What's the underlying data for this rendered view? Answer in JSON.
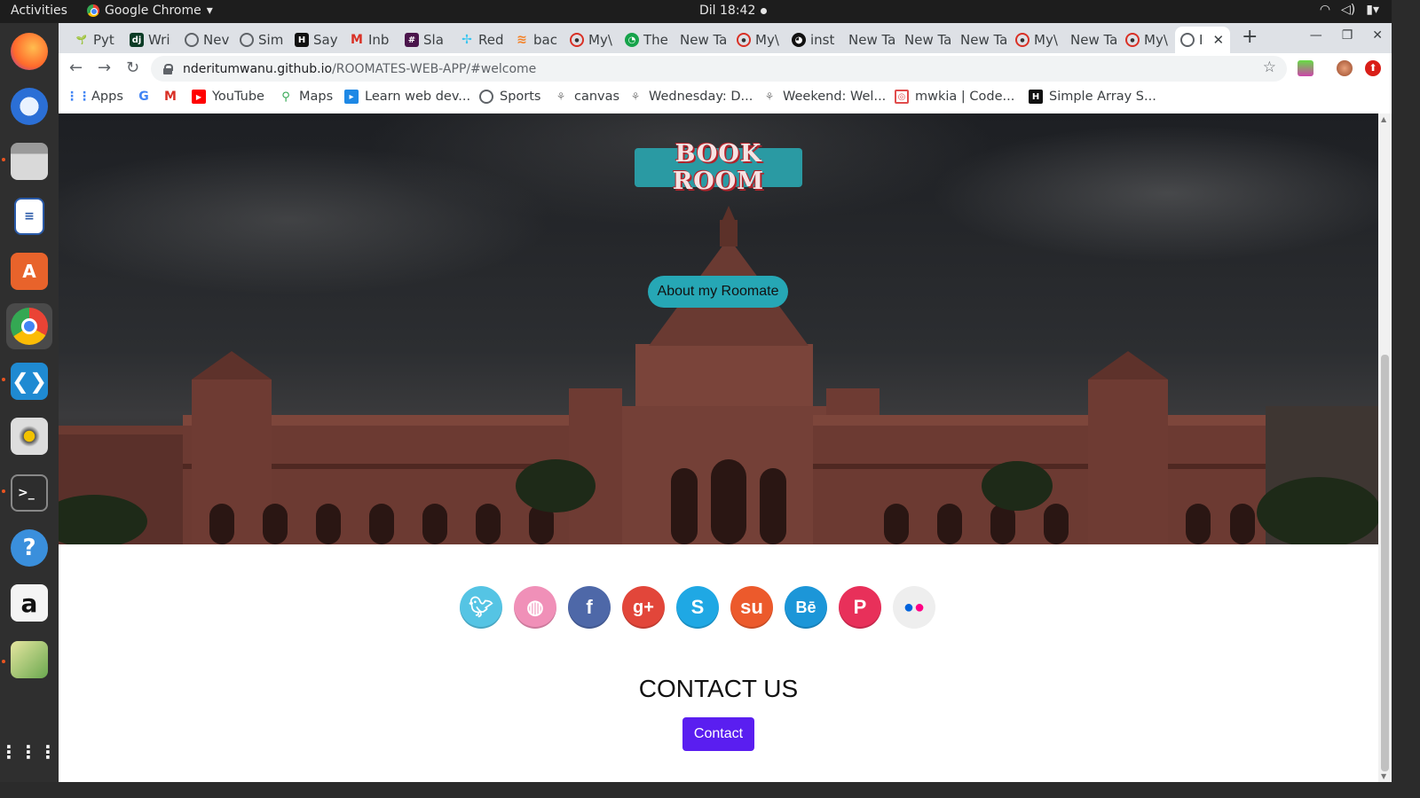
{
  "system": {
    "activities": "Activities",
    "app_name": "Google Chrome",
    "clock": "Dil 18:42"
  },
  "browser": {
    "tabs": [
      {
        "label": "Pyt"
      },
      {
        "label": "Wri"
      },
      {
        "label": "Nev"
      },
      {
        "label": "Sim"
      },
      {
        "label": "Say"
      },
      {
        "label": "Inb"
      },
      {
        "label": "Sla"
      },
      {
        "label": "Red"
      },
      {
        "label": "bac"
      },
      {
        "label": "My\\"
      },
      {
        "label": "The"
      },
      {
        "label": "New Ta"
      },
      {
        "label": "My\\"
      },
      {
        "label": "inst"
      },
      {
        "label": "New Ta"
      },
      {
        "label": "New Ta"
      },
      {
        "label": "New Ta"
      },
      {
        "label": "My\\"
      },
      {
        "label": "New Ta"
      },
      {
        "label": "My\\"
      },
      {
        "label": "I"
      }
    ],
    "url_host": "nderitumwanu.github.io",
    "url_path": "/ROOMATES-WEB-APP/#welcome",
    "bookmarks": [
      {
        "label": "Apps"
      },
      {
        "label": ""
      },
      {
        "label": ""
      },
      {
        "label": "YouTube"
      },
      {
        "label": "Maps"
      },
      {
        "label": "Learn web dev..."
      },
      {
        "label": "Sports"
      },
      {
        "label": "canvas"
      },
      {
        "label": "Wednesday: D..."
      },
      {
        "label": "Weekend: Wel..."
      },
      {
        "label": "mwkia | Code..."
      },
      {
        "label": "Simple Array S..."
      }
    ]
  },
  "page": {
    "book_room": "BOOK ROOM",
    "about_button": "About my Roomate",
    "social_icons": [
      "twitter-icon",
      "dribbble-icon",
      "facebook-icon",
      "google-plus-icon",
      "skype-icon",
      "stumbleupon-icon",
      "behance-icon",
      "pinterest-icon",
      "flickr-icon"
    ],
    "contact_title": "CONTACT US",
    "contact_button": "Contact"
  },
  "colors": {
    "book_room_bg": "#2a9aa3",
    "about_bg": "#26a7b5",
    "contact_bg": "#5a1ef0"
  }
}
